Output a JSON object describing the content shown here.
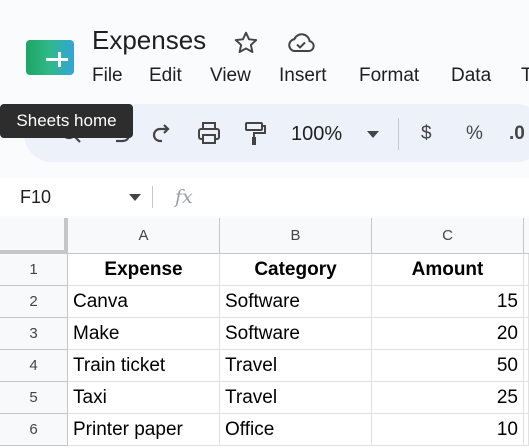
{
  "app": {
    "doc_title": "Expenses",
    "star_icon": "star-outline-icon",
    "cloud_icon": "cloud-saved-icon",
    "logo_icon": "sheets-logo-icon",
    "brand_colors": [
      "#1fa463",
      "#34a5d8"
    ]
  },
  "menu": [
    "File",
    "Edit",
    "View",
    "Insert",
    "Format",
    "Data",
    "T"
  ],
  "tooltip": "Sheets home",
  "toolbar": {
    "zoom": "100%",
    "currency": "$",
    "percent": "%",
    "decimal": ".0",
    "icons": [
      "search-icon",
      "undo-icon",
      "redo-icon",
      "print-icon",
      "paint-format-icon"
    ]
  },
  "formula_bar": {
    "name_box": "F10",
    "fx": "fx",
    "value": ""
  },
  "sheet": {
    "columns": [
      "A",
      "B",
      "C"
    ],
    "rows": [
      {
        "num": "1",
        "cells": [
          "Expense",
          "Category",
          "Amount"
        ]
      },
      {
        "num": "2",
        "cells": [
          "Canva",
          "Software",
          "15"
        ]
      },
      {
        "num": "3",
        "cells": [
          "Make",
          "Software",
          "20"
        ]
      },
      {
        "num": "4",
        "cells": [
          "Train ticket",
          "Travel",
          "50"
        ]
      },
      {
        "num": "5",
        "cells": [
          "Taxi",
          "Travel",
          "25"
        ]
      },
      {
        "num": "6",
        "cells": [
          "Printer paper",
          "Office",
          "10"
        ]
      }
    ]
  }
}
